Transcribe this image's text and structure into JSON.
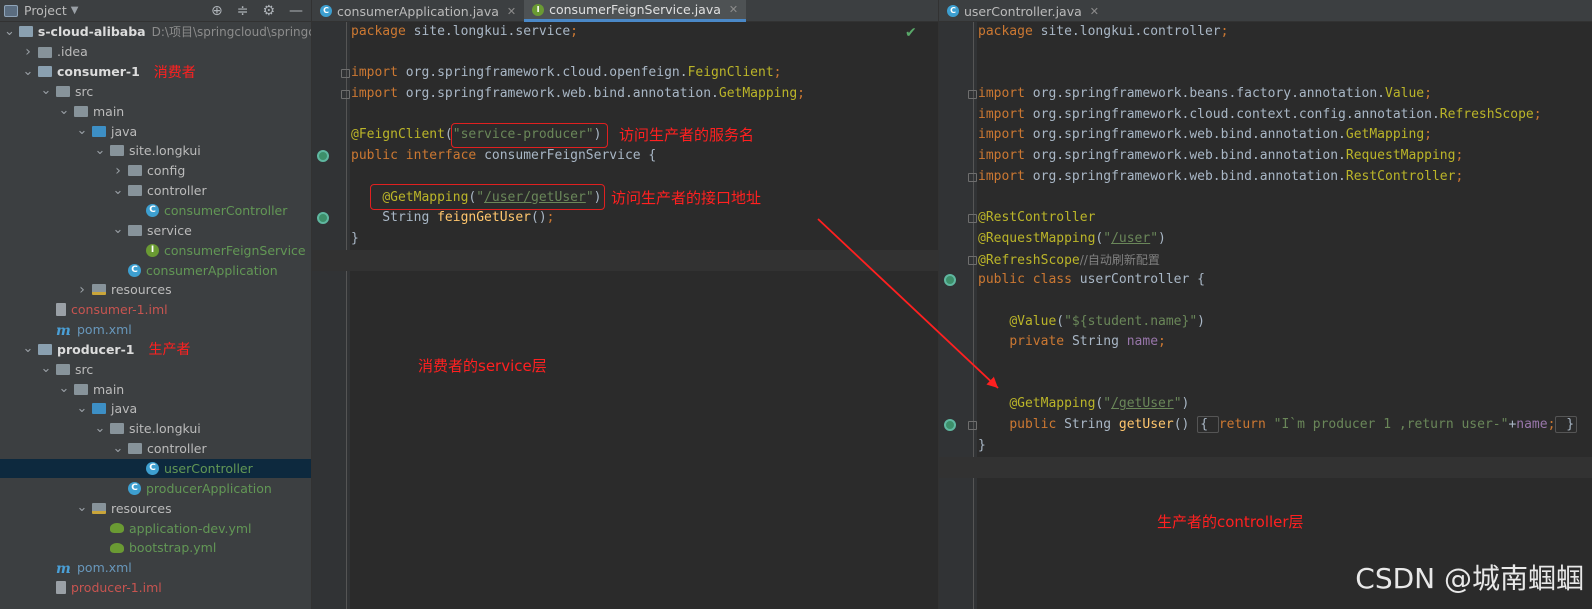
{
  "project_panel": {
    "title": "Project",
    "tree": [
      {
        "depth": 0,
        "arrow": "down",
        "icon": "module",
        "label": "s-cloud-alibaba",
        "style": "bold",
        "extra": "D:\\项目\\springcloud\\springcl"
      },
      {
        "depth": 1,
        "arrow": "right",
        "icon": "folder",
        "label": ".idea",
        "style": ""
      },
      {
        "depth": 1,
        "arrow": "down",
        "icon": "module",
        "label": "consumer-1",
        "style": "bold",
        "annot": "消费者"
      },
      {
        "depth": 2,
        "arrow": "down",
        "icon": "folder",
        "label": "src",
        "style": ""
      },
      {
        "depth": 3,
        "arrow": "down",
        "icon": "folder",
        "label": "main",
        "style": ""
      },
      {
        "depth": 4,
        "arrow": "down",
        "icon": "src",
        "label": "java",
        "style": ""
      },
      {
        "depth": 5,
        "arrow": "down",
        "icon": "pkg",
        "label": "site.longkui",
        "style": ""
      },
      {
        "depth": 6,
        "arrow": "right",
        "icon": "pkg",
        "label": "config",
        "style": ""
      },
      {
        "depth": 6,
        "arrow": "down",
        "icon": "pkg",
        "label": "controller",
        "style": ""
      },
      {
        "depth": 7,
        "arrow": "",
        "icon": "class",
        "label": "consumerController",
        "style": "green"
      },
      {
        "depth": 6,
        "arrow": "down",
        "icon": "pkg",
        "label": "service",
        "style": ""
      },
      {
        "depth": 7,
        "arrow": "",
        "icon": "interface",
        "label": "consumerFeignService",
        "style": "green"
      },
      {
        "depth": 6,
        "arrow": "",
        "icon": "app",
        "label": "consumerApplication",
        "style": "green"
      },
      {
        "depth": 4,
        "arrow": "right",
        "icon": "res",
        "label": "resources",
        "style": ""
      },
      {
        "depth": 2,
        "arrow": "",
        "icon": "iml",
        "label": "consumer-1.iml",
        "style": "red"
      },
      {
        "depth": 2,
        "arrow": "",
        "icon": "maven",
        "label": "pom.xml",
        "style": "blue"
      },
      {
        "depth": 1,
        "arrow": "down",
        "icon": "module",
        "label": "producer-1",
        "style": "bold",
        "annot": "生产者"
      },
      {
        "depth": 2,
        "arrow": "down",
        "icon": "folder",
        "label": "src",
        "style": ""
      },
      {
        "depth": 3,
        "arrow": "down",
        "icon": "folder",
        "label": "main",
        "style": ""
      },
      {
        "depth": 4,
        "arrow": "down",
        "icon": "src",
        "label": "java",
        "style": ""
      },
      {
        "depth": 5,
        "arrow": "down",
        "icon": "pkg",
        "label": "site.longkui",
        "style": ""
      },
      {
        "depth": 6,
        "arrow": "down",
        "icon": "pkg",
        "label": "controller",
        "style": ""
      },
      {
        "depth": 7,
        "arrow": "",
        "icon": "class",
        "label": "userController",
        "style": "green",
        "selected": true
      },
      {
        "depth": 6,
        "arrow": "",
        "icon": "app",
        "label": "producerApplication",
        "style": "green"
      },
      {
        "depth": 4,
        "arrow": "down",
        "icon": "res",
        "label": "resources",
        "style": ""
      },
      {
        "depth": 5,
        "arrow": "",
        "icon": "yml",
        "label": "application-dev.yml",
        "style": "green"
      },
      {
        "depth": 5,
        "arrow": "",
        "icon": "yml",
        "label": "bootstrap.yml",
        "style": "green"
      },
      {
        "depth": 2,
        "arrow": "",
        "icon": "maven",
        "label": "pom.xml",
        "style": "blue"
      },
      {
        "depth": 2,
        "arrow": "",
        "icon": "iml",
        "label": "producer-1.iml",
        "style": "red"
      }
    ]
  },
  "left_editor": {
    "tabs": [
      {
        "label": "consumerApplication.java",
        "icon": "C",
        "color": "#3d9fd0",
        "active": false
      },
      {
        "label": "consumerFeignService.java",
        "icon": "I",
        "color": "#6a9a33",
        "active": true
      }
    ],
    "lines": [
      [
        [
          "kw",
          "package "
        ],
        [
          "cls",
          "site.longkui.service"
        ],
        [
          "kw",
          ";"
        ]
      ],
      [],
      [
        [
          "kw",
          "import "
        ],
        [
          "cls",
          "org.springframework.cloud.openfeign."
        ],
        [
          "ann",
          "FeignClient"
        ],
        [
          "kw",
          ";"
        ]
      ],
      [
        [
          "kw",
          "import "
        ],
        [
          "cls",
          "org.springframework.web.bind.annotation."
        ],
        [
          "ann",
          "GetMapping"
        ],
        [
          "kw",
          ";"
        ]
      ],
      [],
      [
        [
          "ann",
          "@FeignClient"
        ],
        [
          "cls",
          "("
        ],
        [
          "str",
          "\"service-producer\""
        ],
        [
          "cls",
          ")"
        ]
      ],
      [
        [
          "kw",
          "public interface "
        ],
        [
          "cls",
          "consumerFeignService {"
        ]
      ],
      [],
      [
        [
          "cls",
          "    "
        ],
        [
          "ann",
          "@GetMapping"
        ],
        [
          "cls",
          "("
        ],
        [
          "str",
          "\""
        ],
        [
          "strul",
          "/user/getUser"
        ],
        [
          "str",
          "\""
        ],
        [
          "cls",
          ")"
        ]
      ],
      [
        [
          "cls",
          "    String "
        ],
        [
          "fn",
          "feignGetUser"
        ],
        [
          "cls",
          "()"
        ],
        [
          "kw",
          ";"
        ]
      ],
      [
        [
          "cls",
          "}"
        ]
      ]
    ],
    "annotations": {
      "feign_name": "访问生产者的服务名",
      "endpoint": "访问生产者的接口地址",
      "layer": "消费者的service层"
    }
  },
  "right_editor": {
    "tabs": [
      {
        "label": "userController.java",
        "icon": "C",
        "color": "#3d9fd0",
        "active": false
      }
    ],
    "lines": [
      [
        [
          "kw",
          "package "
        ],
        [
          "cls",
          "site.longkui.controller"
        ],
        [
          "kw",
          ";"
        ]
      ],
      [],
      [],
      [
        [
          "kw",
          "import "
        ],
        [
          "cls",
          "org.springframework.beans.factory.annotation."
        ],
        [
          "ann",
          "Value"
        ],
        [
          "kw",
          ";"
        ]
      ],
      [
        [
          "kw",
          "import "
        ],
        [
          "cls",
          "org.springframework.cloud.context.config.annotation."
        ],
        [
          "ann",
          "RefreshScope"
        ],
        [
          "kw",
          ";"
        ]
      ],
      [
        [
          "kw",
          "import "
        ],
        [
          "cls",
          "org.springframework.web.bind.annotation."
        ],
        [
          "ann",
          "GetMapping"
        ],
        [
          "kw",
          ";"
        ]
      ],
      [
        [
          "kw",
          "import "
        ],
        [
          "cls",
          "org.springframework.web.bind.annotation."
        ],
        [
          "ann",
          "RequestMapping"
        ],
        [
          "kw",
          ";"
        ]
      ],
      [
        [
          "kw",
          "import "
        ],
        [
          "cls",
          "org.springframework.web.bind.annotation."
        ],
        [
          "ann",
          "RestController"
        ],
        [
          "kw",
          ";"
        ]
      ],
      [],
      [
        [
          "ann",
          "@RestController"
        ]
      ],
      [
        [
          "ann",
          "@RequestMapping"
        ],
        [
          "cls",
          "("
        ],
        [
          "str",
          "\""
        ],
        [
          "strul",
          "/user"
        ],
        [
          "str",
          "\""
        ],
        [
          "cls",
          ")"
        ]
      ],
      [
        [
          "ann",
          "@RefreshScope"
        ],
        [
          "cmt",
          "//自动刷新配置"
        ]
      ],
      [
        [
          "kw",
          "public class "
        ],
        [
          "cls",
          "userController {"
        ]
      ],
      [],
      [
        [
          "cls",
          "    "
        ],
        [
          "ann",
          "@Value"
        ],
        [
          "cls",
          "("
        ],
        [
          "str",
          "\"${student.name}\""
        ],
        [
          "cls",
          ")"
        ]
      ],
      [
        [
          "cls",
          "    "
        ],
        [
          "kw",
          "private "
        ],
        [
          "cls",
          "String "
        ],
        [
          "fld",
          "name"
        ],
        [
          "kw",
          ";"
        ]
      ],
      [],
      [],
      [
        [
          "cls",
          "    "
        ],
        [
          "ann",
          "@GetMapping"
        ],
        [
          "cls",
          "("
        ],
        [
          "str",
          "\""
        ],
        [
          "strul",
          "/getUser"
        ],
        [
          "str",
          "\""
        ],
        [
          "cls",
          ")"
        ]
      ],
      [
        [
          "cls",
          "    "
        ],
        [
          "kw",
          "public "
        ],
        [
          "cls",
          "String "
        ],
        [
          "fn",
          "getUser"
        ],
        [
          "cls",
          "() "
        ],
        [
          "box",
          "{ "
        ],
        [
          "kw",
          "return "
        ],
        [
          "str",
          "\"I`m producer 1 ,return user-\""
        ],
        [
          "cls",
          "+"
        ],
        [
          "fld",
          "name"
        ],
        [
          "kw",
          ";"
        ],
        [
          "box",
          " }"
        ]
      ],
      [
        [
          "cls",
          "}"
        ]
      ]
    ],
    "annotations": {
      "layer": "生产者的controller层"
    }
  },
  "watermark": "CSDN @城南蝈蝈"
}
